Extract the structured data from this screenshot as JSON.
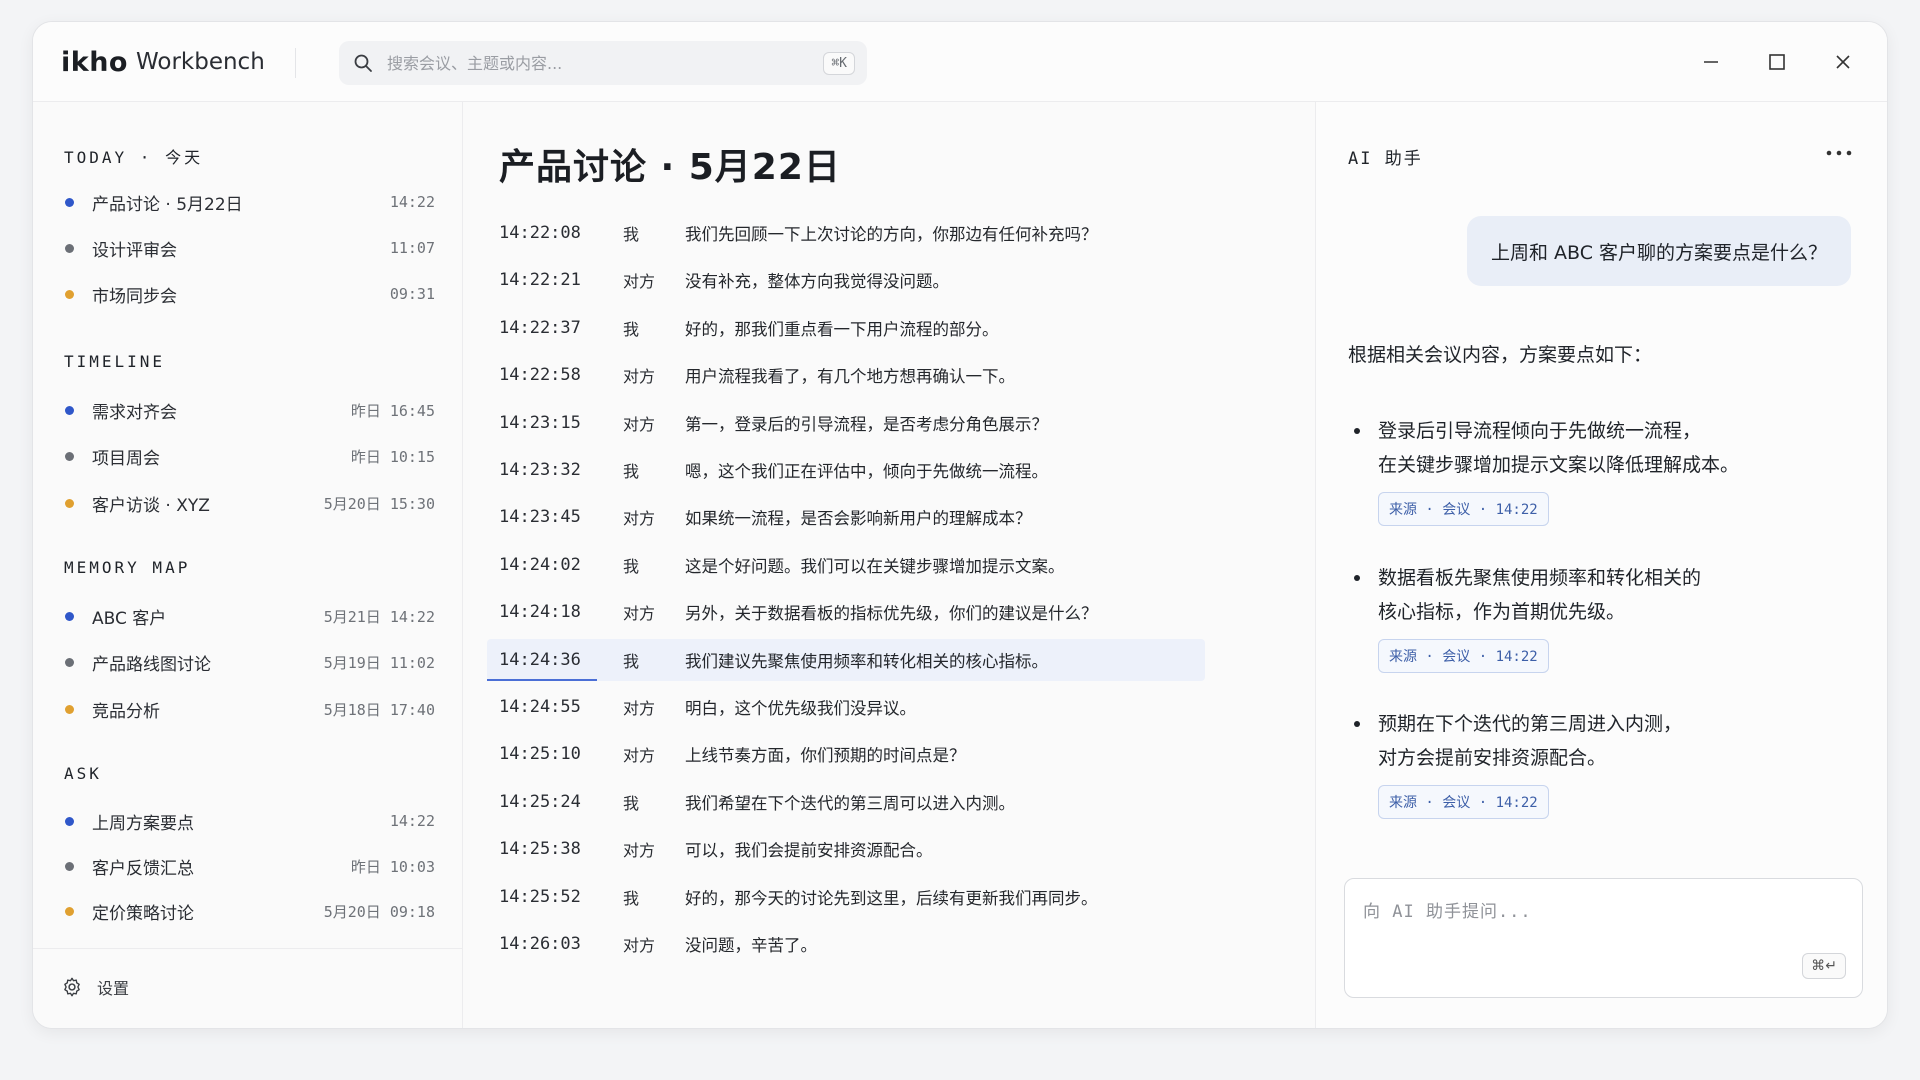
{
  "app": {
    "logo": "ikho",
    "name": "Workbench"
  },
  "search": {
    "placeholder": "搜索会议、主题或内容...",
    "shortcut": "⌘K"
  },
  "window_controls": [
    "minimize-icon",
    "maximize-icon",
    "close-icon"
  ],
  "sidebar": {
    "sections": [
      {
        "title": "TODAY · 今天",
        "items": [
          {
            "label": "产品讨论 · 5月22日",
            "time": "14:22",
            "color": "#2f57c9"
          },
          {
            "label": "设计评审会",
            "time": "11:07",
            "color": "#6b6f76"
          },
          {
            "label": "市场同步会",
            "time": "09:31",
            "color": "#e0a030"
          }
        ]
      },
      {
        "title": "TIMELINE",
        "items": [
          {
            "label": "需求对齐会",
            "time": "昨日 16:45",
            "color": "#2f57c9"
          },
          {
            "label": "项目周会",
            "time": "昨日 10:15",
            "color": "#6b6f76"
          },
          {
            "label": "客户访谈 · XYZ",
            "time": "5月20日 15:30",
            "color": "#e0a030"
          }
        ]
      },
      {
        "title": "MEMORY MAP",
        "items": [
          {
            "label": "ABC 客户",
            "time": "5月21日 14:22",
            "color": "#2f57c9"
          },
          {
            "label": "产品路线图讨论",
            "time": "5月19日 11:02",
            "color": "#6b6f76"
          },
          {
            "label": "竞品分析",
            "time": "5月18日 17:40",
            "color": "#e0a030"
          }
        ]
      },
      {
        "title": "ASK",
        "items": [
          {
            "label": "上周方案要点",
            "time": "14:22",
            "color": "#2f57c9"
          },
          {
            "label": "客户反馈汇总",
            "time": "昨日 10:03",
            "color": "#6b6f76"
          },
          {
            "label": "定价策略讨论",
            "time": "5月20日 09:18",
            "color": "#e0a030"
          }
        ]
      }
    ],
    "settings_label": "设置"
  },
  "transcript": {
    "title": "产品讨论 · 5月22日",
    "active_index": 9,
    "rows": [
      {
        "time": "14:22:08",
        "speaker": "我",
        "text": "我们先回顾一下上次讨论的方向，你那边有任何补充吗？"
      },
      {
        "time": "14:22:21",
        "speaker": "对方",
        "text": "没有补充，整体方向我觉得没问题。"
      },
      {
        "time": "14:22:37",
        "speaker": "我",
        "text": "好的，那我们重点看一下用户流程的部分。"
      },
      {
        "time": "14:22:58",
        "speaker": "对方",
        "text": "用户流程我看了，有几个地方想再确认一下。"
      },
      {
        "time": "14:23:15",
        "speaker": "对方",
        "text": "第一，登录后的引导流程，是否考虑分角色展示？"
      },
      {
        "time": "14:23:32",
        "speaker": "我",
        "text": "嗯，这个我们正在评估中，倾向于先做统一流程。"
      },
      {
        "time": "14:23:45",
        "speaker": "对方",
        "text": "如果统一流程，是否会影响新用户的理解成本？"
      },
      {
        "time": "14:24:02",
        "speaker": "我",
        "text": "这是个好问题。我们可以在关键步骤增加提示文案。"
      },
      {
        "time": "14:24:18",
        "speaker": "对方",
        "text": "另外，关于数据看板的指标优先级，你们的建议是什么？"
      },
      {
        "time": "14:24:36",
        "speaker": "我",
        "text": "我们建议先聚焦使用频率和转化相关的核心指标。"
      },
      {
        "time": "14:24:55",
        "speaker": "对方",
        "text": "明白，这个优先级我们没异议。"
      },
      {
        "time": "14:25:10",
        "speaker": "对方",
        "text": "上线节奏方面，你们预期的时间点是？"
      },
      {
        "time": "14:25:24",
        "speaker": "我",
        "text": "我们希望在下个迭代的第三周可以进入内测。"
      },
      {
        "time": "14:25:38",
        "speaker": "对方",
        "text": "可以，我们会提前安排资源配合。"
      },
      {
        "time": "14:25:52",
        "speaker": "我",
        "text": "好的，那今天的讨论先到这里，后续有更新我们再同步。"
      },
      {
        "time": "14:26:03",
        "speaker": "对方",
        "text": "没问题，辛苦了。"
      }
    ]
  },
  "ai": {
    "title": "AI 助手",
    "question": "上周和 ABC 客户聊的方案要点是什么？",
    "intro": "根据相关会议内容，方案要点如下：",
    "bullets": [
      {
        "line1": "登录后引导流程倾向于先做统一流程，",
        "line2": "在关键步骤增加提示文案以降低理解成本。",
        "source": "来源 · 会议 · 14:22"
      },
      {
        "line1": "数据看板先聚焦使用频率和转化相关的",
        "line2": "核心指标，作为首期优先级。",
        "source": "来源 · 会议 · 14:22"
      },
      {
        "line1": "预期在下个迭代的第三周进入内测，",
        "line2": "对方会提前安排资源配合。",
        "source": "来源 · 会议 · 14:22"
      }
    ],
    "ask_placeholder": "向 AI 助手提问...",
    "send_shortcut": "⌘↵"
  }
}
